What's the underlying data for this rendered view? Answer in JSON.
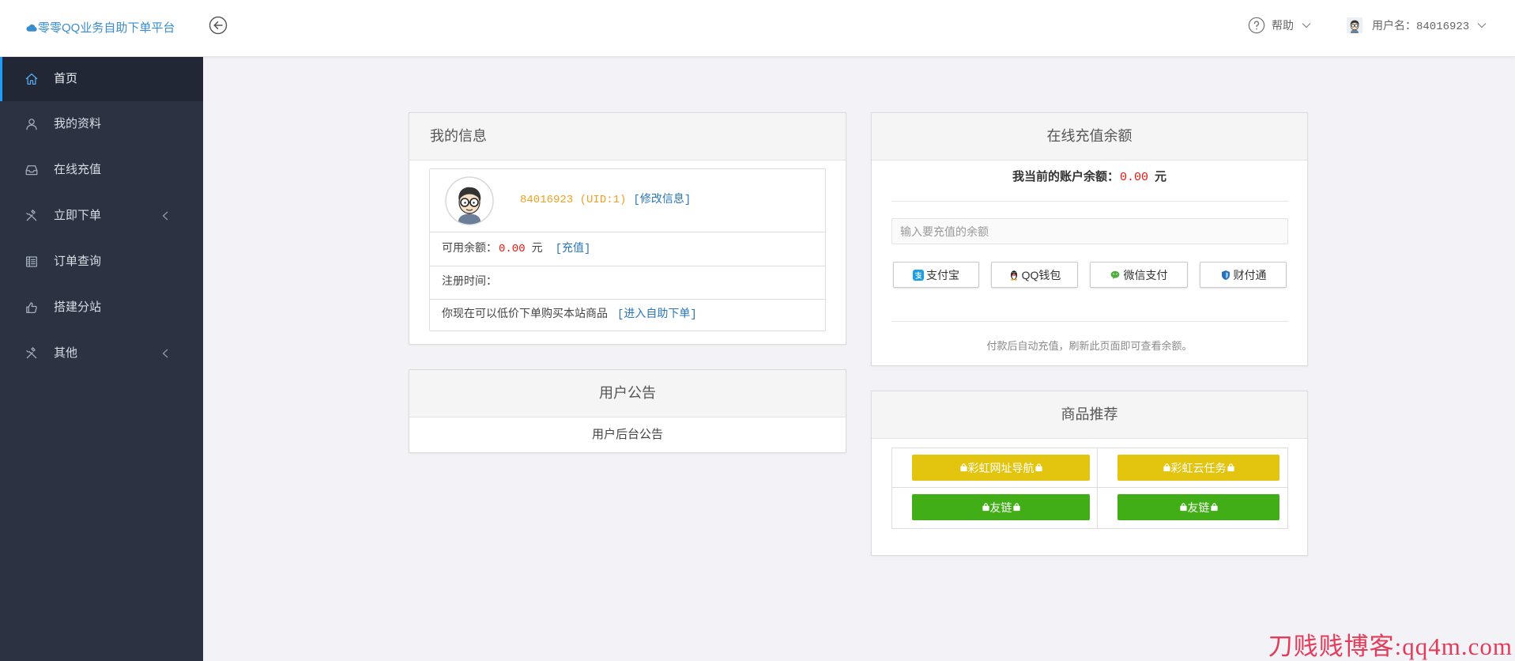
{
  "header": {
    "logo_text": "零零QQ业务自助下单平台",
    "help_label": "帮助",
    "username_label": "用户名：84016923"
  },
  "sidebar": {
    "items": [
      {
        "label": "首页",
        "icon": "home-icon"
      },
      {
        "label": "我的资料",
        "icon": "user-icon"
      },
      {
        "label": "在线充值",
        "icon": "inbox-icon"
      },
      {
        "label": "立即下单",
        "icon": "tools-icon"
      },
      {
        "label": "订单查询",
        "icon": "order-list-icon"
      },
      {
        "label": "搭建分站",
        "icon": "thumbs-up-icon"
      },
      {
        "label": "其他",
        "icon": "tools-icon"
      }
    ]
  },
  "my_info": {
    "title": "我的信息",
    "uid_text": "84016923 (UID:1)",
    "edit_link": "[修改信息]",
    "balance_label": "可用余额：",
    "balance_value": "0.00",
    "balance_unit": "元",
    "recharge_link": "[充值]",
    "register_label": "注册时间：",
    "order_hint": "你现在可以低价下单购买本站商品",
    "order_link": "[进入自助下单]"
  },
  "notice": {
    "title": "用户公告",
    "content": "用户后台公告"
  },
  "recharge": {
    "title": "在线充值余额",
    "balance_label": "我当前的账户余额：",
    "balance_value": "0.00",
    "balance_unit": "元",
    "amount_placeholder": "输入要充值的余额",
    "pay_buttons": [
      {
        "label": "支付宝",
        "icon": "alipay-icon"
      },
      {
        "label": "QQ钱包",
        "icon": "qq-wallet-icon"
      },
      {
        "label": "微信支付",
        "icon": "wechat-pay-icon"
      },
      {
        "label": "财付通",
        "icon": "tenpay-icon"
      }
    ],
    "note": "付款后自动充值，刷新此页面即可查看余额。"
  },
  "recommend": {
    "title": "商品推荐",
    "links": [
      {
        "label": "彩虹网址导航",
        "color": "#e3c40f",
        "icon": "bag-icon"
      },
      {
        "label": "彩虹云任务",
        "color": "#e3c40f",
        "icon": "bag-icon"
      },
      {
        "label": "友链",
        "color": "#41ae17",
        "icon": "bag-icon"
      },
      {
        "label": "友链",
        "color": "#41ae17",
        "icon": "bag-icon"
      }
    ]
  },
  "watermark": "刀贱贱博客:qq4m.com",
  "colors": {
    "accent": "#1e9fff",
    "link": "#2a76b8",
    "uid": "#f0a020",
    "money": "#e8160c",
    "sidebar_bg": "#2b3342",
    "page_bg": "#f3f3f7"
  }
}
